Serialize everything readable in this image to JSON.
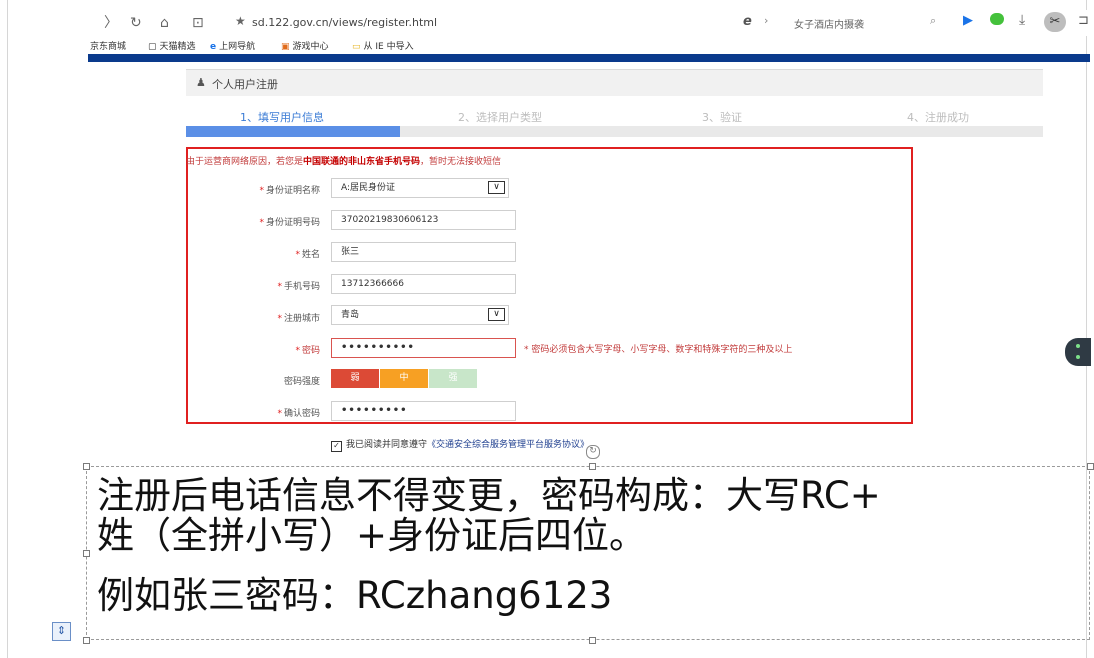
{
  "browser": {
    "url": "sd.122.gov.cn/views/register.html",
    "search_text": "女子酒店内摄袭",
    "nav_back": "〈",
    "nav_forward": "〉",
    "nav_refresh": "↻",
    "nav_home": "⌂",
    "nav_reader": "⊡"
  },
  "bookmarks": [
    {
      "label": "京东商城",
      "icon": ""
    },
    {
      "label": "天猫精选",
      "icon": "▢"
    },
    {
      "label": "上网导航",
      "icon": "e"
    },
    {
      "label": "游戏中心",
      "icon": "▣"
    },
    {
      "label": "从 IE 中导入",
      "icon": "▭"
    }
  ],
  "page": {
    "panel_title": "个人用户注册",
    "steps": [
      "1、填写用户信息",
      "2、选择用户类型",
      "3、验证",
      "4、注册成功"
    ],
    "active_step": 1,
    "progress_fraction": 0.25,
    "notice_prefix": "由于运营商网络原因，若您是",
    "notice_highlight": "中国联通的非山东省手机号码",
    "notice_suffix": "，暂时无法接收短信",
    "required_mark": "*",
    "form": {
      "id_type_label": "身份证明名称",
      "id_type_value": "A:居民身份证",
      "id_number_label": "身份证明号码",
      "id_number_value": "370202198306061 23",
      "name_label": "姓名",
      "name_value": "张三",
      "phone_label": "手机号码",
      "phone_value": "13712366666",
      "city_label": "注册城市",
      "city_value": "青岛",
      "password_label": "密码",
      "password_value": "••••••••••",
      "password_hint": "* 密码必须包含大写字母、小写字母、数字和特殊字符的三种及以上",
      "strength_label": "密码强度",
      "strength_levels": [
        "弱",
        "中",
        "强"
      ],
      "strength_colors": [
        "#dc4a36",
        "#f7a023",
        "#c8e6c9"
      ],
      "confirm_label": "确认密码",
      "confirm_value": "•••••••••",
      "dropdown_glyph": "∨"
    },
    "agreement_prefix": "我已阅读并同意遵守",
    "agreement_link": "《交通安全综合服务管理平台服务协议》",
    "agreement_checked": "✓"
  },
  "annotation": {
    "line1": "注册后电话信息不得变更，密码构成：大写RC+",
    "line2": "姓（全拼小写）+身份证后四位。",
    "line3": "例如张三密码：RCzhang6123"
  },
  "colors": {
    "accent_blue": "#3a7bd5",
    "highlight_red": "#e02020",
    "brand_band": "#0a3a8c"
  }
}
